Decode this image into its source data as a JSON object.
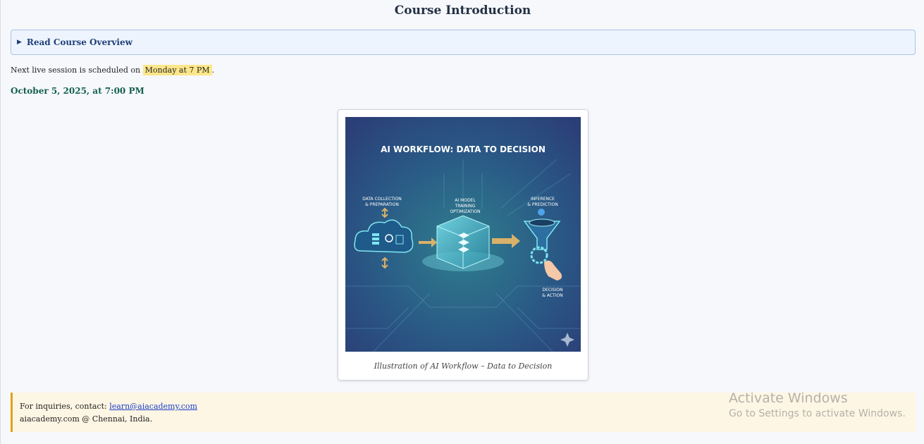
{
  "header": {
    "title": "Course Introduction"
  },
  "overview": {
    "label": "Read Course Overview",
    "expanded": false
  },
  "session": {
    "prefix": "Next live session is scheduled on",
    "highlight": "Monday at 7 PM",
    "suffix": ".",
    "date": "October 5, 2025, at 7:00 PM"
  },
  "figure": {
    "art": {
      "title": "AI WORKFLOW: DATA TO DECISION",
      "stage1": [
        "DATA COLLECTION",
        "& PREPARATION"
      ],
      "stage2": [
        "AI MODEL",
        "TRAINING",
        "OPTIMIZATION"
      ],
      "stage3": [
        "INFERENCE",
        "& PREDICTION"
      ],
      "stage4": [
        "DECISION",
        "& ACTION"
      ]
    },
    "caption": "Illustration of AI Workflow – Data to Decision"
  },
  "footer": {
    "contact_prefix": "For inquiries, contact: ",
    "email": "learn@aiacademy.com",
    "location": "aiacademy.com @ Chennai, India."
  },
  "watermark": {
    "line1": "Activate Windows",
    "line2": "Go to Settings to activate Windows."
  },
  "colors": {
    "accent_blue": "#1f3f7a",
    "date_green": "#14604f",
    "highlight": "#fde68a",
    "footer_border": "#e0a21b"
  }
}
